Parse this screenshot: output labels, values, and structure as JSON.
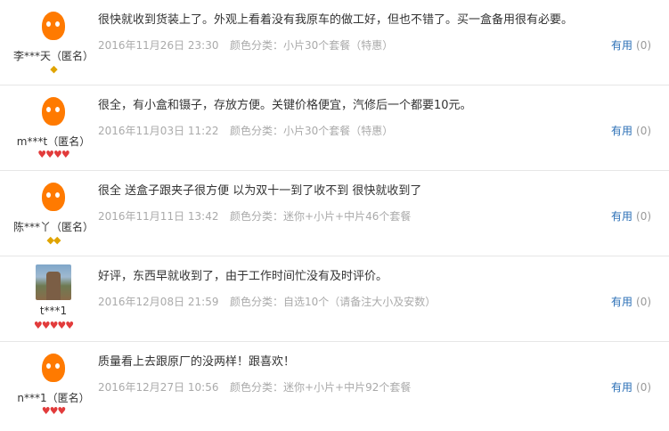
{
  "reviews": [
    {
      "user": "李***天（匿名）",
      "avatar": "mascot-icon",
      "badge": {
        "type": "diamond",
        "count": 1,
        "text": "◆"
      },
      "content": "很快就收到货装上了。外观上看着没有我原车的做工好，但也不错了。买一盒备用很有必要。",
      "date": "2016年11月26日 23:30",
      "sku": "颜色分类：小片30个套餐（特惠）",
      "useful_label": "有用",
      "useful_count": "(0)"
    },
    {
      "user": "m***t（匿名）",
      "avatar": "mascot-icon",
      "badge": {
        "type": "heart",
        "count": 4,
        "text": "♥♥♥♥"
      },
      "content": "很全，有小盒和镊子，存放方便。关键价格便宜，汽修后一个都要10元。",
      "date": "2016年11月03日 11:22",
      "sku": "颜色分类：小片30个套餐（特惠）",
      "useful_label": "有用",
      "useful_count": "(0)"
    },
    {
      "user": "陈***丫（匿名）",
      "avatar": "mascot-icon",
      "badge": {
        "type": "diamond",
        "count": 2,
        "text": "◆◆"
      },
      "content": "很全 送盒子跟夹子很方便 以为双十一到了收不到 很快就收到了",
      "date": "2016年11月11日 13:42",
      "sku": "颜色分类：迷你+小片+中片46个套餐",
      "useful_label": "有用",
      "useful_count": "(0)"
    },
    {
      "user": "t***1",
      "avatar": "photo-avatar",
      "badge": {
        "type": "heart",
        "count": 5,
        "text": "♥♥♥♥♥"
      },
      "content": "好评，东西早就收到了，由于工作时间忙没有及时评价。",
      "date": "2016年12月08日 21:59",
      "sku": "颜色分类：自选10个（请备注大小及安数）",
      "useful_label": "有用",
      "useful_count": "(0)"
    },
    {
      "user": "n***1（匿名）",
      "avatar": "mascot-icon",
      "badge": {
        "type": "heart",
        "count": 3,
        "text": "♥♥♥"
      },
      "content": "质量看上去跟原厂的没两样！跟喜欢！",
      "date": "2016年12月27日 10:56",
      "sku": "颜色分类：迷你+小片+中片92个套餐",
      "useful_label": "有用",
      "useful_count": "(0)"
    }
  ]
}
